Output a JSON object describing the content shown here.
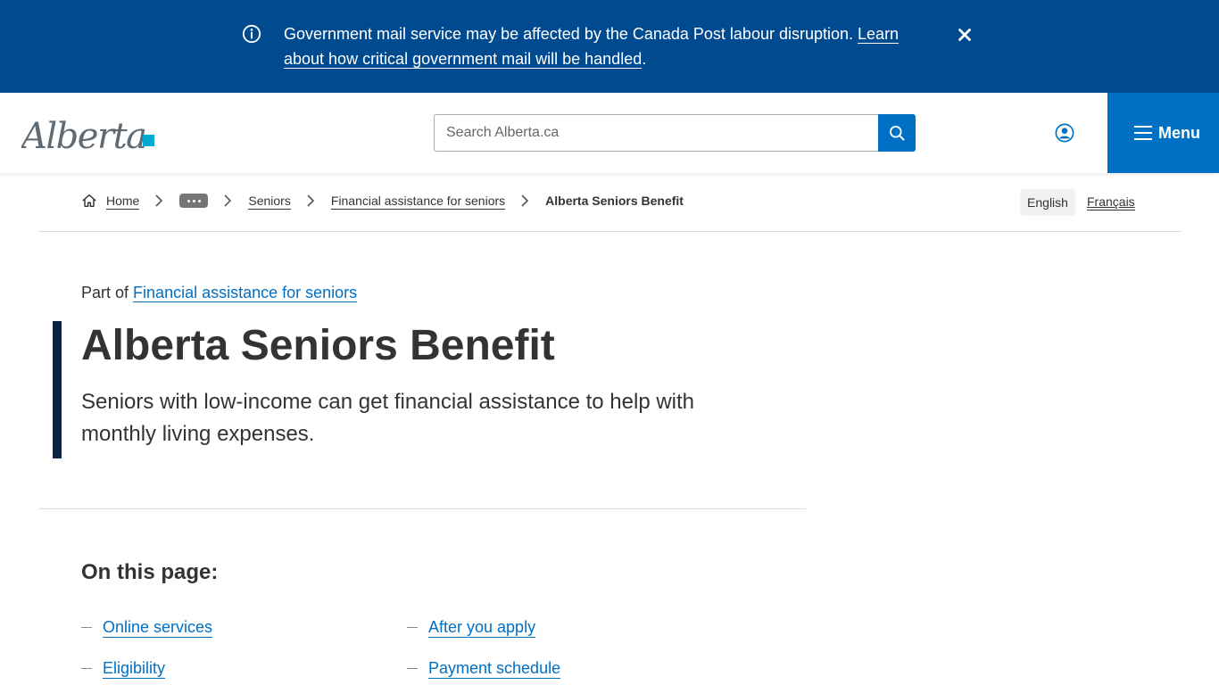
{
  "notice": {
    "text": "Government mail service may be affected by the Canada Post labour disruption.",
    "link": "Learn about how critical government mail will be handled",
    "suffix": "."
  },
  "header": {
    "logo_text": "Alberta",
    "search_placeholder": "Search Alberta.ca",
    "menu_label": "Menu"
  },
  "breadcrumb": {
    "home": "Home",
    "items": [
      "Seniors",
      "Financial assistance for seniors"
    ],
    "current": "Alberta Seniors Benefit"
  },
  "language": {
    "english": "English",
    "french": "Français"
  },
  "hero": {
    "part_of_prefix": "Part of",
    "part_of_link": "Financial assistance for seniors",
    "title": "Alberta Seniors Benefit",
    "lead": "Seniors with low-income can get financial assistance to help with monthly living expenses."
  },
  "on_this_page": {
    "heading": "On this page:",
    "links": [
      "Online services",
      "After you apply",
      "Eligibility",
      "Payment schedule"
    ]
  },
  "colors": {
    "banner": "#004a8f",
    "brand_blue": "#0070c4",
    "hero_bar": "#0c2340",
    "logo_teal": "#00aad2"
  }
}
